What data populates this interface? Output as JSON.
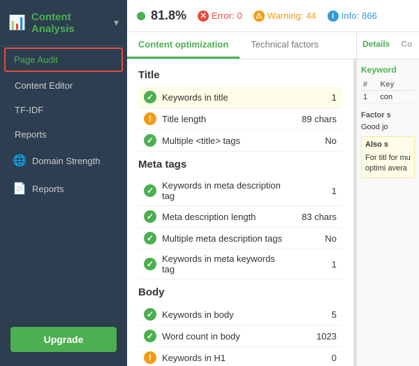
{
  "sidebar": {
    "title": "Content Analysis",
    "header_icon": "📊",
    "items": [
      {
        "id": "page-audit",
        "label": "Page Audit",
        "active": true
      },
      {
        "id": "content-editor",
        "label": "Content Editor",
        "active": false
      },
      {
        "id": "tf-idf",
        "label": "TF-IDF",
        "active": false
      },
      {
        "id": "reports",
        "label": "Reports",
        "active": false
      }
    ],
    "sections": [
      {
        "id": "domain-strength",
        "label": "Domain Strength",
        "icon": "🌐"
      },
      {
        "id": "reports-section",
        "label": "Reports",
        "icon": "📄"
      }
    ],
    "upgrade_label": "Upgrade"
  },
  "topbar": {
    "score": "81.8%",
    "error_label": "Error:",
    "error_count": "0",
    "warning_label": "Warning:",
    "warning_count": "44",
    "info_label": "Info:",
    "info_count": "866"
  },
  "tabs": [
    {
      "id": "content-optimization",
      "label": "Content optimization",
      "active": true
    },
    {
      "id": "technical-factors",
      "label": "Technical factors",
      "active": false
    }
  ],
  "right_panel": {
    "tabs": [
      {
        "id": "details",
        "label": "Details",
        "active": true
      },
      {
        "id": "co",
        "label": "Co",
        "active": false
      }
    ],
    "keyword_subtitle": "Keyword",
    "table_headers": [
      "#",
      "Key"
    ],
    "table_rows": [
      {
        "num": "1",
        "keyword": "con"
      }
    ],
    "factor_label": "Factor s",
    "factor_text": "Good jo",
    "also_label": "Also s",
    "for_title_text": "For titl for mu optimi avera"
  },
  "sections": [
    {
      "id": "title-section",
      "title": "Title",
      "items": [
        {
          "id": "keywords-in-title",
          "label": "Keywords in title",
          "status": "ok",
          "value": "1",
          "highlighted": true
        },
        {
          "id": "title-length",
          "label": "Title length",
          "status": "warn",
          "value": "89 chars",
          "highlighted": false
        },
        {
          "id": "multiple-title-tags",
          "label": "Multiple <title> tags",
          "status": "ok",
          "value": "No",
          "highlighted": false
        }
      ]
    },
    {
      "id": "meta-tags-section",
      "title": "Meta tags",
      "items": [
        {
          "id": "keywords-in-meta-desc",
          "label": "Keywords in meta description tag",
          "status": "ok",
          "value": "1",
          "highlighted": false
        },
        {
          "id": "meta-desc-length",
          "label": "Meta description length",
          "status": "ok",
          "value": "83 chars",
          "highlighted": false
        },
        {
          "id": "multiple-meta-desc",
          "label": "Multiple meta description tags",
          "status": "ok",
          "value": "No",
          "highlighted": false
        },
        {
          "id": "keywords-in-meta-kw",
          "label": "Keywords in meta keywords tag",
          "status": "ok",
          "value": "1",
          "highlighted": false
        }
      ]
    },
    {
      "id": "body-section",
      "title": "Body",
      "items": [
        {
          "id": "keywords-in-body",
          "label": "Keywords in body",
          "status": "ok",
          "value": "5",
          "highlighted": false
        },
        {
          "id": "word-count-in-body",
          "label": "Word count in body",
          "status": "ok",
          "value": "1023",
          "highlighted": false
        },
        {
          "id": "keywords-in-h1",
          "label": "Keywords in H1",
          "status": "warn",
          "value": "0",
          "highlighted": false
        }
      ]
    }
  ]
}
